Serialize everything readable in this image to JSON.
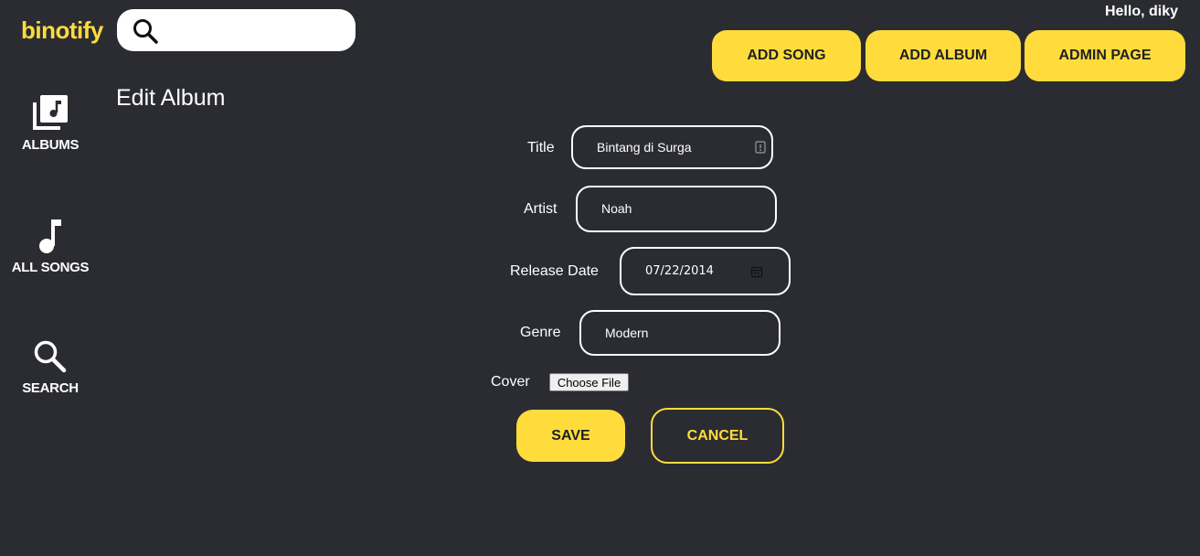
{
  "header": {
    "logo": "binotify",
    "search_placeholder": "",
    "greeting": "Hello, diky",
    "buttons": {
      "add_song": "ADD SONG",
      "add_album": "ADD ALBUM",
      "admin_page": "ADMIN PAGE"
    }
  },
  "sidebar": {
    "items": [
      {
        "label": "ALBUMS",
        "icon": "album-library-icon"
      },
      {
        "label": "ALL SONGS",
        "icon": "music-note-icon"
      },
      {
        "label": "SEARCH",
        "icon": "search-icon"
      }
    ]
  },
  "main": {
    "title": "Edit Album",
    "form": {
      "title_label": "Title",
      "title_value": "Bintang di Surga",
      "artist_label": "Artist",
      "artist_value": "Noah",
      "release_label": "Release Date",
      "release_value": "07/22/2014",
      "genre_label": "Genre",
      "genre_value": "Modern",
      "cover_label": "Cover",
      "file_button": "Choose File",
      "save": "SAVE",
      "cancel": "CANCEL"
    }
  },
  "colors": {
    "background": "#2b2c32",
    "accent": "#ffdc3c",
    "text": "#ffffff"
  }
}
